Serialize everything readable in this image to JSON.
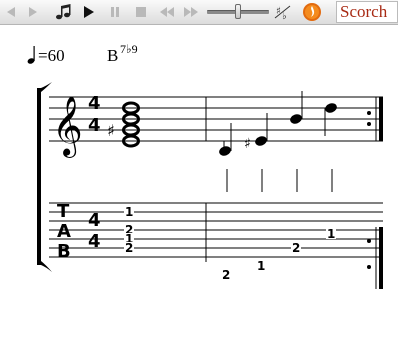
{
  "toolbar": {
    "buttons": [
      {
        "name": "back-icon"
      },
      {
        "name": "forward-icon"
      },
      {
        "name": "note-mode-icon"
      },
      {
        "name": "play-icon"
      },
      {
        "name": "pause-icon"
      },
      {
        "name": "stop-icon"
      },
      {
        "name": "rewind-icon"
      },
      {
        "name": "fast-forward-icon"
      },
      {
        "name": "transpose-icon"
      },
      {
        "name": "scorch-plugin-icon"
      }
    ],
    "brand_label": "Scorch",
    "tempo_slider_level": 0.5
  },
  "score": {
    "tempo_value": "=60",
    "chord_symbol_root": "B",
    "chord_symbol_ext": "7♭9",
    "time_signature": {
      "top": "4",
      "bottom": "4"
    },
    "tab_letters": [
      "T",
      "A",
      "B"
    ],
    "tab_frets": {
      "measure1_chord": [
        "1",
        "2",
        "1",
        "2"
      ],
      "measure2_notes": [
        "2",
        "1",
        "2",
        "1"
      ]
    }
  }
}
